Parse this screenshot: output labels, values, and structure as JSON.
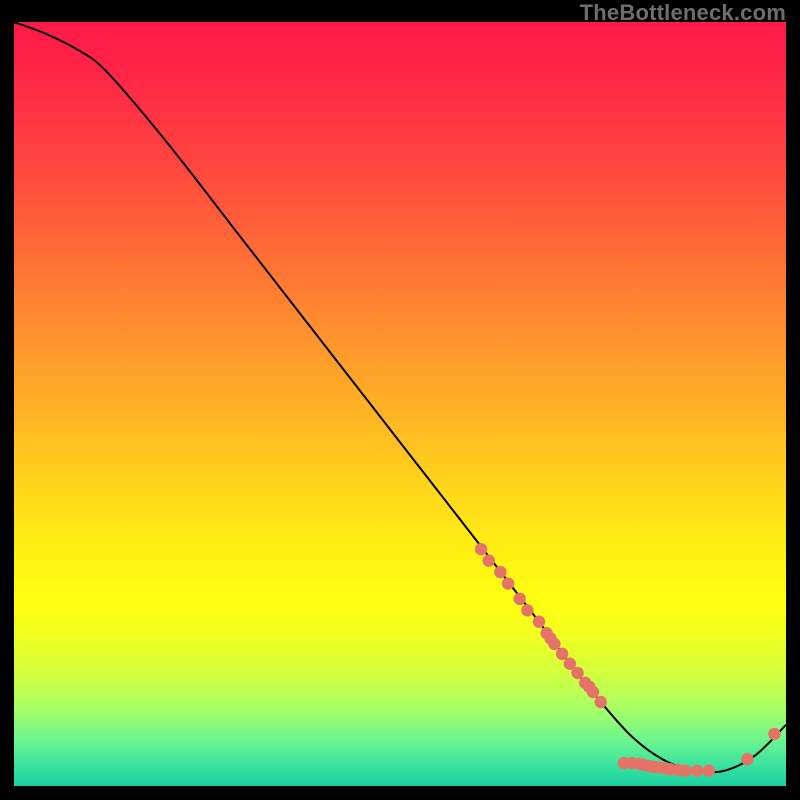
{
  "watermark": "TheBottleneck.com",
  "chart_data": {
    "type": "line",
    "title": "",
    "xlabel": "",
    "ylabel": "",
    "xlim": [
      0,
      100
    ],
    "ylim": [
      0,
      100
    ],
    "series": [
      {
        "name": "curve",
        "x": [
          0,
          4,
          8,
          12,
          20,
          30,
          40,
          50,
          60,
          68,
          72,
          76,
          80,
          84,
          88,
          92,
          96,
          100
        ],
        "y": [
          100,
          98.5,
          96.5,
          93.5,
          84,
          71,
          58,
          45,
          32,
          21.5,
          16,
          11,
          6.5,
          3.5,
          2,
          2,
          4,
          8
        ]
      }
    ],
    "markers": [
      {
        "x": 60.5,
        "y": 31.0
      },
      {
        "x": 61.5,
        "y": 29.5
      },
      {
        "x": 63.0,
        "y": 28.0
      },
      {
        "x": 64.0,
        "y": 26.5
      },
      {
        "x": 65.5,
        "y": 24.5
      },
      {
        "x": 66.5,
        "y": 23.0
      },
      {
        "x": 68.0,
        "y": 21.5
      },
      {
        "x": 69.0,
        "y": 20.0
      },
      {
        "x": 69.5,
        "y": 19.3
      },
      {
        "x": 70.0,
        "y": 18.6
      },
      {
        "x": 71.0,
        "y": 17.3
      },
      {
        "x": 72.0,
        "y": 16.0
      },
      {
        "x": 73.0,
        "y": 14.8
      },
      {
        "x": 74.0,
        "y": 13.5
      },
      {
        "x": 74.5,
        "y": 13.0
      },
      {
        "x": 75.0,
        "y": 12.3
      },
      {
        "x": 76.0,
        "y": 11.0
      },
      {
        "x": 79.0,
        "y": 3.0
      },
      {
        "x": 80.0,
        "y": 3.0
      },
      {
        "x": 81.0,
        "y": 2.9
      },
      {
        "x": 81.5,
        "y": 2.8
      },
      {
        "x": 82.3,
        "y": 2.6
      },
      {
        "x": 83.0,
        "y": 2.5
      },
      {
        "x": 83.8,
        "y": 2.4
      },
      {
        "x": 84.5,
        "y": 2.3
      },
      {
        "x": 85.0,
        "y": 2.2
      },
      {
        "x": 86.0,
        "y": 2.1
      },
      {
        "x": 87.0,
        "y": 2.0
      },
      {
        "x": 88.5,
        "y": 2.0
      },
      {
        "x": 90.0,
        "y": 2.0
      },
      {
        "x": 95.0,
        "y": 3.5
      },
      {
        "x": 98.5,
        "y": 6.8
      }
    ],
    "gradient_stops": [
      {
        "offset": 0.0,
        "color": "#ff1a49"
      },
      {
        "offset": 0.05,
        "color": "#ff2147"
      },
      {
        "offset": 0.12,
        "color": "#ff3343"
      },
      {
        "offset": 0.2,
        "color": "#ff4a3e"
      },
      {
        "offset": 0.3,
        "color": "#ff6c36"
      },
      {
        "offset": 0.4,
        "color": "#ff8e2e"
      },
      {
        "offset": 0.5,
        "color": "#ffb025"
      },
      {
        "offset": 0.6,
        "color": "#ffd21c"
      },
      {
        "offset": 0.7,
        "color": "#fff212"
      },
      {
        "offset": 0.76,
        "color": "#feff10"
      },
      {
        "offset": 0.8,
        "color": "#f2ff1f"
      },
      {
        "offset": 0.85,
        "color": "#d4ff3c"
      },
      {
        "offset": 0.9,
        "color": "#a6ff66"
      },
      {
        "offset": 0.94,
        "color": "#6cf58e"
      },
      {
        "offset": 0.97,
        "color": "#3fe49f"
      },
      {
        "offset": 1.0,
        "color": "#18d0a0"
      }
    ],
    "marker_color": "#e57368",
    "line_color": "#000000"
  }
}
